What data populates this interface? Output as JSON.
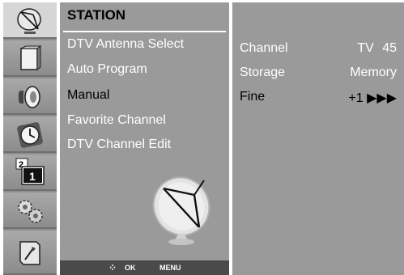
{
  "menu": {
    "title": "STATION",
    "items": [
      {
        "label": "DTV Antenna Select"
      },
      {
        "label": "Auto Program"
      },
      {
        "label": "Manual"
      },
      {
        "label": "Favorite Channel"
      },
      {
        "label": "DTV Channel Edit"
      }
    ],
    "selected_index": 2
  },
  "sidebar": {
    "icons": [
      "satellite-dish-icon",
      "picture-icon",
      "speaker-icon",
      "clock-icon",
      "pip-screen-icon",
      "gears-icon",
      "setup-icon"
    ],
    "pip_number": "2",
    "pip_number_main": "1",
    "selected_index": 0
  },
  "details": {
    "rows": [
      {
        "label": "Channel",
        "value": "TV  45"
      },
      {
        "label": "Storage",
        "value": "Memory"
      },
      {
        "label": "Fine",
        "value": "+1 ▶▶▶"
      }
    ]
  },
  "footer": {
    "nav_glyph": "⁘",
    "ok_label": "OK",
    "menu_label": "MENU"
  },
  "colors": {
    "panel": "#9a9a9a",
    "footer": "#4a4a4a",
    "selected_text": "#000000",
    "normal_text": "#ffffff"
  }
}
